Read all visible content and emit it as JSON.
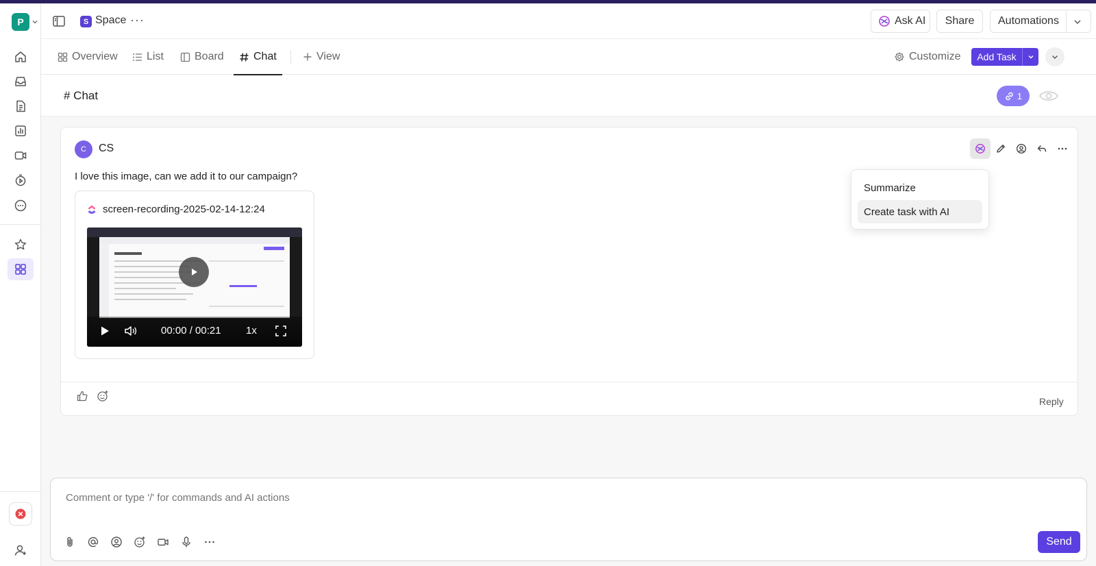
{
  "workspace": {
    "initial": "P",
    "color": "#0f9a84"
  },
  "breadcrumb": {
    "space_initial": "S",
    "space_name": "Space"
  },
  "header_buttons": {
    "ask_ai": "Ask AI",
    "share": "Share",
    "automations": "Automations"
  },
  "view_tabs": {
    "overview": "Overview",
    "list": "List",
    "board": "Board",
    "chat": "Chat",
    "add_view": "View",
    "active": "Chat"
  },
  "toolbar": {
    "customize": "Customize",
    "add_task": "Add Task"
  },
  "chat_header": {
    "title": "# Chat",
    "links_count": "1"
  },
  "message": {
    "avatar_initial": "C",
    "author": "CS",
    "text": "I love this image, can we add it to our campaign?",
    "attachment": {
      "file_name": "screen-recording-2025-02-14-12:24",
      "time_display": "00:00 / 00:21",
      "speed": "1x"
    },
    "reply_label": "Reply"
  },
  "ai_menu": {
    "items": [
      "Summarize",
      "Create task with AI"
    ],
    "highlighted": "Create task with AI"
  },
  "composer": {
    "placeholder": "Comment or type '/' for commands and AI actions",
    "send_label": "Send"
  },
  "colors": {
    "accent": "#5b3fe0",
    "pill": "#8b7cf6",
    "danger": "#e5484d"
  }
}
